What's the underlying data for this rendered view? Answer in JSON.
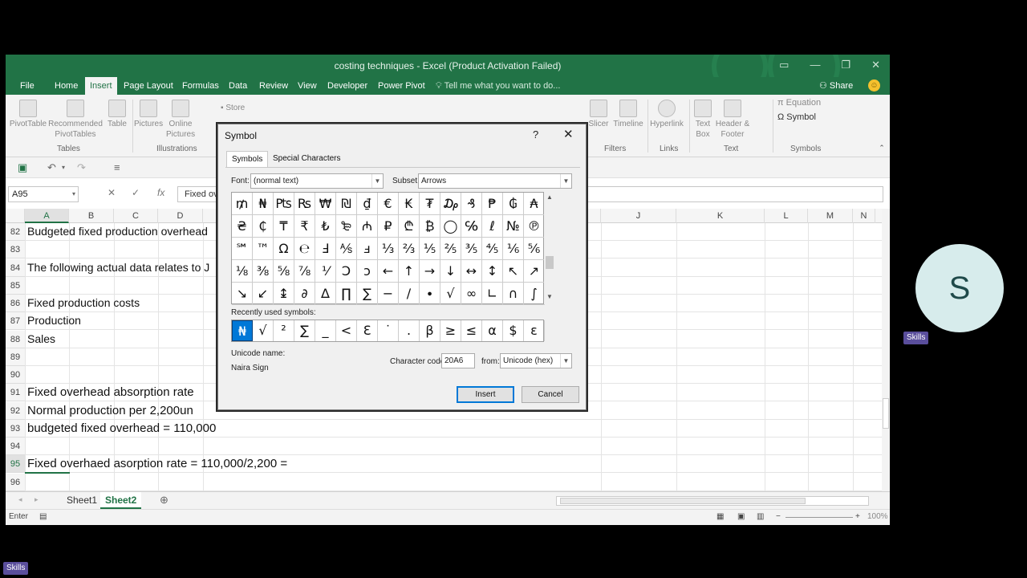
{
  "window": {
    "title": "costing techniques - Excel (Product Activation Failed)"
  },
  "ribbon_tabs": [
    "File",
    "Home",
    "Insert",
    "Page Layout",
    "Formulas",
    "Data",
    "Review",
    "View",
    "Developer",
    "Power Pivot"
  ],
  "tell_me": "Tell me what you want to do...",
  "share": "Share",
  "ribbon": {
    "pivottable": "PivotTable",
    "recommended": "Recommended PivotTables",
    "table": "Table",
    "pictures": "Pictures",
    "online_pictures": "Online Pictures",
    "store": "Store",
    "slicer": "Slicer",
    "timeline": "Timeline",
    "hyperlink": "Hyperlink",
    "textbox": "Text Box",
    "header_footer": "Header & Footer",
    "equation": "Equation",
    "symbol": "Symbol",
    "groups": {
      "tables": "Tables",
      "illustrations": "Illustrations",
      "filters": "Filters",
      "links": "Links",
      "text": "Text",
      "symbols": "Symbols"
    }
  },
  "formula_bar": {
    "name_box": "A95",
    "content": "Fixed ov"
  },
  "columns": [
    "A",
    "B",
    "C",
    "D",
    "J",
    "K",
    "L",
    "M",
    "N"
  ],
  "rows": [
    {
      "num": "82",
      "text": "Budgeted fixed production overhead"
    },
    {
      "num": "83",
      "text": ""
    },
    {
      "num": "84",
      "text": "The following actual data relates to J"
    },
    {
      "num": "85",
      "text": ""
    },
    {
      "num": "86",
      "text": "Fixed production costs"
    },
    {
      "num": "87",
      "text": "Production"
    },
    {
      "num": "88",
      "text": "Sales"
    },
    {
      "num": "89",
      "text": ""
    },
    {
      "num": "90",
      "text": ""
    },
    {
      "num": "91",
      "text": "Fixed overhead absorption rate"
    },
    {
      "num": "92",
      "text": "Normal production per 2,200un"
    },
    {
      "num": "93",
      "text": "budgeted fixed overhead = 110,000"
    },
    {
      "num": "94",
      "text": ""
    },
    {
      "num": "95",
      "text": "Fixed overhaed asorption rate = 110,000/2,200 ="
    },
    {
      "num": "96",
      "text": ""
    }
  ],
  "sheets": [
    "Sheet1",
    "Sheet2"
  ],
  "status": {
    "mode": "Enter",
    "zoom": "100%"
  },
  "dialog": {
    "title": "Symbol",
    "help": "?",
    "close": "✕",
    "tabs": [
      "Symbols",
      "Special Characters"
    ],
    "font_label": "Font:",
    "font_value": "(normal text)",
    "subset_label": "Subset:",
    "subset_value": "Arrows",
    "symbols": [
      [
        "₥",
        "₦",
        "₧",
        "₨",
        "₩",
        "₪",
        "₫",
        "€",
        "₭",
        "₮",
        "₯",
        "₰",
        "₱",
        "₲",
        "₳"
      ],
      [
        "₴",
        "₵",
        "₸",
        "₹",
        "₺",
        "₻",
        "₼",
        "₽",
        "₾",
        "₿",
        "◯",
        "℅",
        "ℓ",
        "№",
        "℗"
      ],
      [
        "℠",
        "™",
        "Ω",
        "℮",
        "Ⅎ",
        "⅍",
        "ⅎ",
        "⅓",
        "⅔",
        "⅕",
        "⅖",
        "⅗",
        "⅘",
        "⅙",
        "⅚"
      ],
      [
        "⅛",
        "⅜",
        "⅝",
        "⅞",
        "⅟",
        "Ↄ",
        "ↄ",
        "←",
        "↑",
        "→",
        "↓",
        "↔",
        "↕",
        "↖",
        "↗"
      ],
      [
        "↘",
        "↙",
        "↨",
        "∂",
        "∆",
        "∏",
        "∑",
        "−",
        "∕",
        "∙",
        "√",
        "∞",
        "∟",
        "∩",
        "∫"
      ]
    ],
    "recent_label": "Recently used symbols:",
    "recent": [
      "₦",
      "√",
      "²",
      "∑",
      "_",
      "<",
      "Ɛ",
      "˙",
      ".",
      "β",
      "≥",
      "≤",
      "α",
      "$",
      "ε"
    ],
    "unicode_name_label": "Unicode name:",
    "unicode_name": "Naira Sign",
    "char_code_label": "Character code:",
    "char_code": "20A6",
    "from_label": "from:",
    "from_value": "Unicode (hex)",
    "insert": "Insert",
    "cancel": "Cancel"
  },
  "participant": {
    "initial": "S",
    "tag": "Skills"
  },
  "bottom_tag": "Skills"
}
